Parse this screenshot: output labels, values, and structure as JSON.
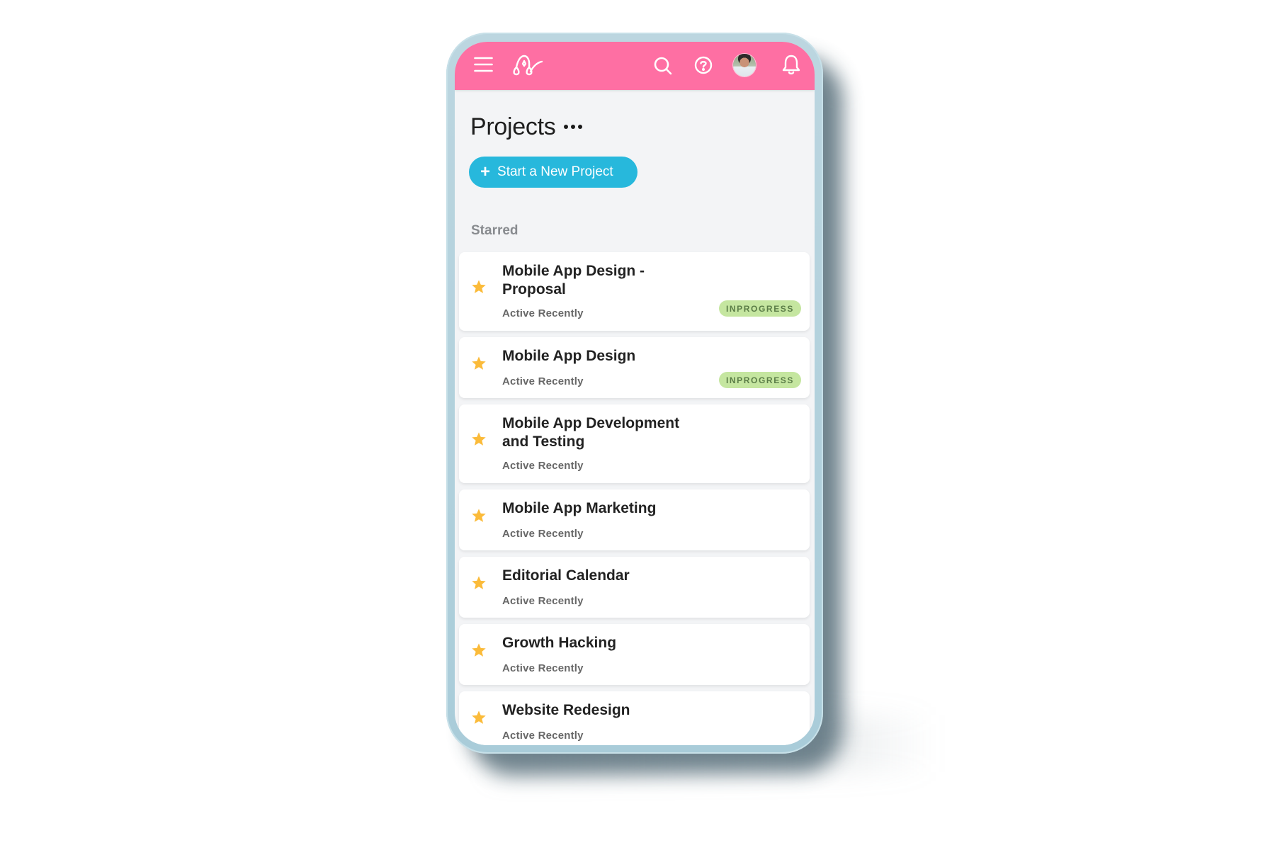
{
  "header": {
    "menu_icon": "hamburger-menu-icon",
    "logo_icon": "app-logo-icon",
    "search_icon": "search-icon",
    "help_icon": "help-icon",
    "avatar": "user-avatar",
    "notifications_icon": "bell-icon",
    "background_color": "#fe6fa3"
  },
  "page": {
    "title": "Projects",
    "more_icon": "ellipsis-icon",
    "new_project_button": {
      "icon": "plus-icon",
      "label": "Start a New Project",
      "color": "#27b8dc"
    }
  },
  "starred": {
    "section_label": "Starred",
    "projects": [
      {
        "title_line1": "Mobile App Design -",
        "title_line2": "Proposal",
        "subtitle": "Active Recently",
        "status": "INPROGRESS"
      },
      {
        "title_line1": "Mobile App Design",
        "title_line2": "",
        "subtitle": "Active Recently",
        "status": "INPROGRESS"
      },
      {
        "title_line1": "Mobile App Development",
        "title_line2": "and Testing",
        "subtitle": "Active Recently",
        "status": ""
      },
      {
        "title_line1": "Mobile App Marketing",
        "title_line2": "",
        "subtitle": "Active Recently",
        "status": ""
      },
      {
        "title_line1": "Editorial Calendar",
        "title_line2": "",
        "subtitle": "Active Recently",
        "status": ""
      },
      {
        "title_line1": "Growth Hacking",
        "title_line2": "",
        "subtitle": "Active Recently",
        "status": ""
      },
      {
        "title_line1": "Website Redesign",
        "title_line2": "",
        "subtitle": "Active Recently",
        "status": ""
      }
    ],
    "star_color": "#fbbb3a",
    "badge_color": "#c5e6a0"
  }
}
